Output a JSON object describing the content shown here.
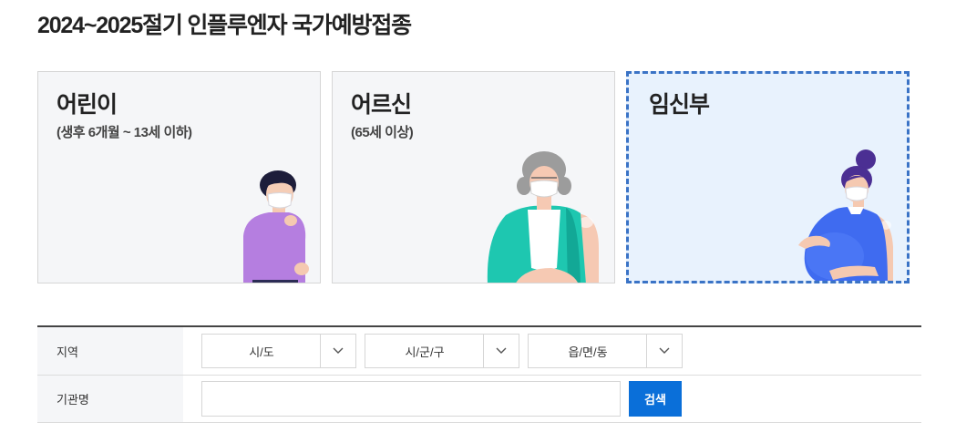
{
  "page": {
    "title": "2024~2025절기 인플루엔자 국가예방접종"
  },
  "cards": [
    {
      "title": "어린이",
      "subtitle": "(생후 6개월 ~ 13세 이하)",
      "selected": false
    },
    {
      "title": "어르신",
      "subtitle": "(65세 이상)",
      "selected": false
    },
    {
      "title": "임신부",
      "subtitle": "",
      "selected": true
    }
  ],
  "form": {
    "region_label": "지역",
    "selects": [
      {
        "value": "시/도"
      },
      {
        "value": "시/군/구"
      },
      {
        "value": "읍/면/동"
      }
    ],
    "institution_label": "기관명",
    "institution_value": "",
    "search_label": "검색"
  },
  "colors": {
    "accent": "#0a6fd9",
    "selected_border": "#3a73c6",
    "selected_bg": "#e8f2fd",
    "card_bg": "#f5f6f8"
  }
}
